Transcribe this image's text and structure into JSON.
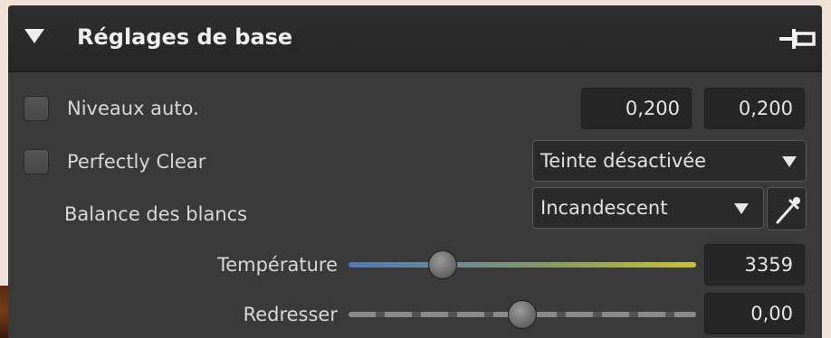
{
  "panel": {
    "title": "Réglages de base",
    "icons": {
      "collapse": "triangle-down-icon",
      "pin": "pin-icon"
    }
  },
  "niveaux_auto": {
    "label": "Niveaux auto.",
    "checked": false,
    "value_low": "0,200",
    "value_high": "0,200"
  },
  "perfectly_clear": {
    "label": "Perfectly Clear",
    "checked": false,
    "dropdown_value": "Teinte désactivée"
  },
  "white_balance": {
    "label": "Balance des blancs",
    "dropdown_value": "Incandescent",
    "picker_icon": "eyedropper-icon"
  },
  "temperature": {
    "label": "Température",
    "value": "3359",
    "slider_fraction": 0.27,
    "gradient_colors": [
      "#4e7ab5",
      "#7a9a6e",
      "#c8c23a"
    ]
  },
  "redresser": {
    "label": "Redresser",
    "value": "0,00",
    "slider_fraction": 0.5
  },
  "colors": {
    "panel_bg": "#3a3a3a",
    "header_bg": "#2a2a2a",
    "text": "#d8d8d8"
  }
}
